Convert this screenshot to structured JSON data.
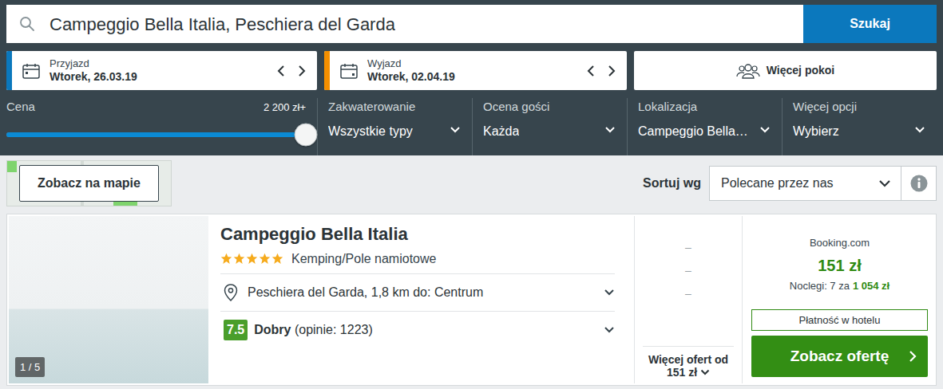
{
  "search": {
    "value": "Campeggio Bella Italia, Peschiera del Garda",
    "button": "Szukaj"
  },
  "dates": [
    {
      "label": "Przyjazd",
      "value": "Wtorek, 26.03.19",
      "color": "#0b78bd"
    },
    {
      "label": "Wyjazd",
      "value": "Wtorek, 02.04.19",
      "color": "#f48f00"
    }
  ],
  "rooms": "Więcej pokoi",
  "filters": {
    "price": {
      "label": "Cena",
      "reading": "2 200 zł+",
      "level": 1
    },
    "dropdowns": [
      {
        "label": "Zakwaterowanie",
        "value": "Wszystkie typy"
      },
      {
        "label": "Ocena gości",
        "value": "Każda"
      },
      {
        "label": "Lokalizacja",
        "value": "Campeggio Bella…"
      },
      {
        "label": "Więcej opcji",
        "value": "Wybierz"
      }
    ]
  },
  "map_button": "Zobacz na mapie",
  "sort": {
    "label": "Sortuj wg",
    "value": "Polecane przez nas"
  },
  "result": {
    "title": "Campeggio Bella Italia",
    "stars": 5,
    "type": "Kemping/Pole namiotowe",
    "image_counter": "1 / 5",
    "location": "Peschiera del Garda, 1,8 km do: Centrum",
    "rating": {
      "score": "7.5",
      "label": "Dobry",
      "count": "(opinie: 1223)"
    },
    "other_offers": [
      "–",
      "–",
      "–"
    ],
    "more_offers": {
      "text": "Więcej ofert od",
      "price": "151 zł"
    },
    "deal": {
      "provider": "Booking.com",
      "price": "151 zł",
      "nights": "Noclegi: 7 za",
      "total": "1 054 zł",
      "payment": "Płatność w hotelu",
      "button": "Zobacz ofertę"
    }
  }
}
